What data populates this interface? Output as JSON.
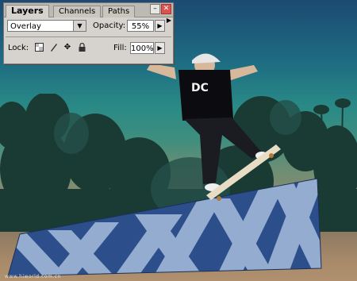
{
  "palette": {
    "tabs": [
      {
        "label": "Layers",
        "active": true
      },
      {
        "label": "Channels",
        "active": false
      },
      {
        "label": "Paths",
        "active": false
      }
    ],
    "blend_mode": "Overlay",
    "opacity_label": "Opacity:",
    "opacity_value": "55%",
    "lock_label": "Lock:",
    "fill_label": "Fill:",
    "fill_value": "100%",
    "icons": [
      "minimize-icon",
      "close-icon",
      "palette-menu-icon",
      "lock-transparent-icon",
      "lock-paint-icon",
      "lock-move-icon",
      "lock-all-icon"
    ]
  },
  "shirt_logo": "DC",
  "watermark": "www.hiworld.com.cn",
  "colors": {
    "sky_top": "#1c4a72",
    "sky_mid": "#2a8a86",
    "ramp_blue": "#2c4f8c",
    "ramp_stripe": "#9fb6d6"
  }
}
